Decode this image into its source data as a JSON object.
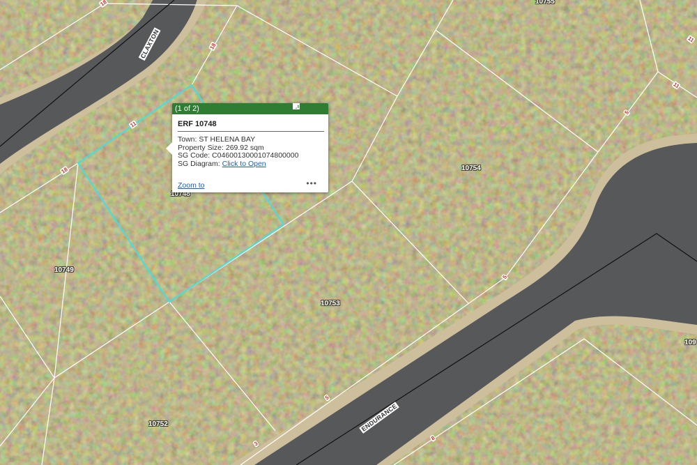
{
  "map": {
    "erf_labels": [
      "10748",
      "10749",
      "10753",
      "10754",
      "10752",
      "10755",
      "109"
    ],
    "road_labels": [
      "CLAXTON",
      "ENDURANCE"
    ],
    "dimension_labels": [
      "18",
      "18",
      "11",
      "18",
      "11",
      "11",
      "5",
      "3",
      "8",
      "12"
    ],
    "colors": {
      "vegetation": "#6f6a3c",
      "road": "#57595a",
      "road_edge": "#cfc0a0",
      "parcel_line": "#ffffff",
      "highlight": "#40e0e0"
    }
  },
  "popup": {
    "counter": "(1 of 2)",
    "title": "ERF 10748",
    "fields": [
      {
        "label": "Town:",
        "value": "ST HELENA BAY"
      },
      {
        "label": "Property Size:",
        "value": "269.92 sqm"
      },
      {
        "label": "SG Code:",
        "value": "C04600130001074800000"
      },
      {
        "label": "SG Diagram:",
        "value": "Click to Open"
      }
    ],
    "zoom_link": "Zoom to",
    "more_label": "•••",
    "icons": {
      "next": "play-icon",
      "maximize": "maximize-icon",
      "close": "close-icon"
    }
  }
}
